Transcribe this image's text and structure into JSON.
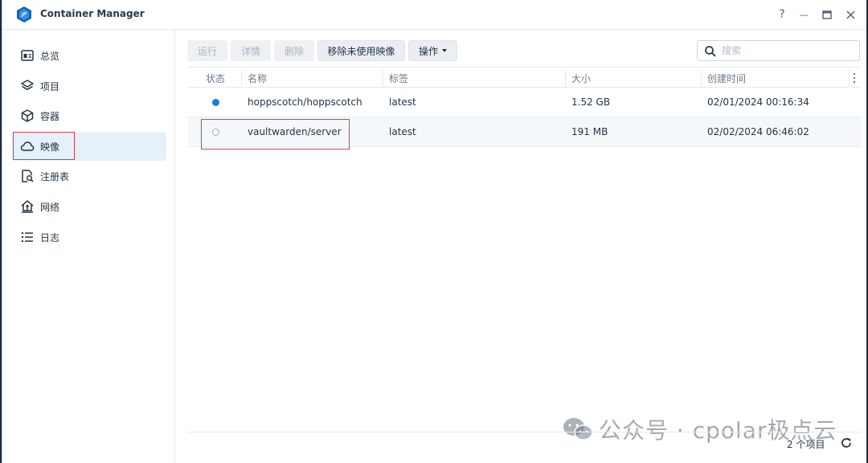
{
  "window": {
    "title": "Container Manager",
    "controls": {
      "help": "?",
      "minimize": "—",
      "maximize": "□",
      "close": "✕"
    }
  },
  "sidebar": {
    "items": [
      {
        "label": "总览",
        "icon": "overview-icon"
      },
      {
        "label": "项目",
        "icon": "layers-icon"
      },
      {
        "label": "容器",
        "icon": "box-icon"
      },
      {
        "label": "映像",
        "icon": "cloud-icon",
        "active": true
      },
      {
        "label": "注册表",
        "icon": "registry-icon"
      },
      {
        "label": "网络",
        "icon": "network-icon"
      },
      {
        "label": "日志",
        "icon": "log-icon"
      }
    ]
  },
  "toolbar": {
    "run": "运行",
    "details": "详情",
    "delete": "删除",
    "remove_unused": "移除未使用映像",
    "actions": "操作"
  },
  "search": {
    "placeholder": "搜索",
    "value": ""
  },
  "table": {
    "headers": {
      "status": "状态",
      "name": "名称",
      "tag": "标签",
      "size": "大小",
      "created": "创建时间"
    },
    "rows": [
      {
        "status": "running",
        "name": "hoppscotch/hoppscotch",
        "tag": "latest",
        "size": "1.52 GB",
        "created": "02/01/2024 00:16:34"
      },
      {
        "status": "stopped",
        "name": "vaultwarden/server",
        "tag": "latest",
        "size": "191 MB",
        "created": "02/02/2024 06:46:02"
      }
    ]
  },
  "footer": {
    "count": "2 个项目"
  },
  "watermark": {
    "text": "公众号 · cpolar极点云"
  },
  "colors": {
    "accent": "#1a7ad4",
    "highlight": "#e03c4b",
    "active_bg": "#e6f0fa"
  }
}
